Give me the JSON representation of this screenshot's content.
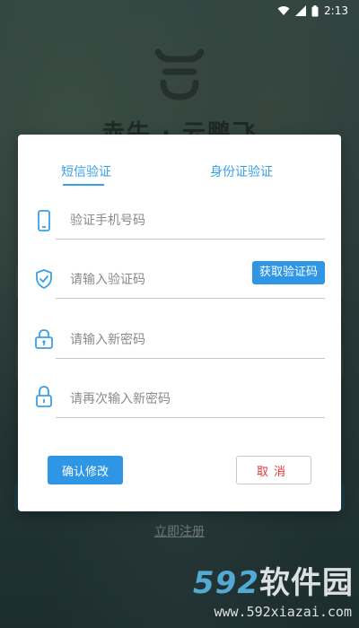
{
  "status_bar": {
    "time": "2:13"
  },
  "background": {
    "brand_text": "赤牛 · 云鹏飞",
    "register_link": "立即注册"
  },
  "dialog": {
    "tabs": [
      {
        "label": "短信验证",
        "active": true
      },
      {
        "label": "身份证验证",
        "active": false
      }
    ],
    "fields": {
      "phone": {
        "placeholder": "验证手机号码",
        "value": "",
        "icon": "phone-icon"
      },
      "code": {
        "placeholder": "请输入验证码",
        "value": "",
        "icon": "shield-check-icon"
      },
      "new_password": {
        "placeholder": "请输入新密码",
        "value": "",
        "icon": "lock-icon"
      },
      "repeat_password": {
        "placeholder": "请再次输入新密码",
        "value": "",
        "icon": "lock-icon"
      }
    },
    "get_code_label": "获取验证码",
    "confirm_label": "确认修改",
    "cancel_label": "取消"
  },
  "watermark": {
    "prefix": "592",
    "suffix": "软件园",
    "url": "www.592xiazai.com"
  },
  "colors": {
    "accent": "#2f96e6",
    "tab": "#3aa0e8",
    "cancel": "#e23a3a"
  }
}
